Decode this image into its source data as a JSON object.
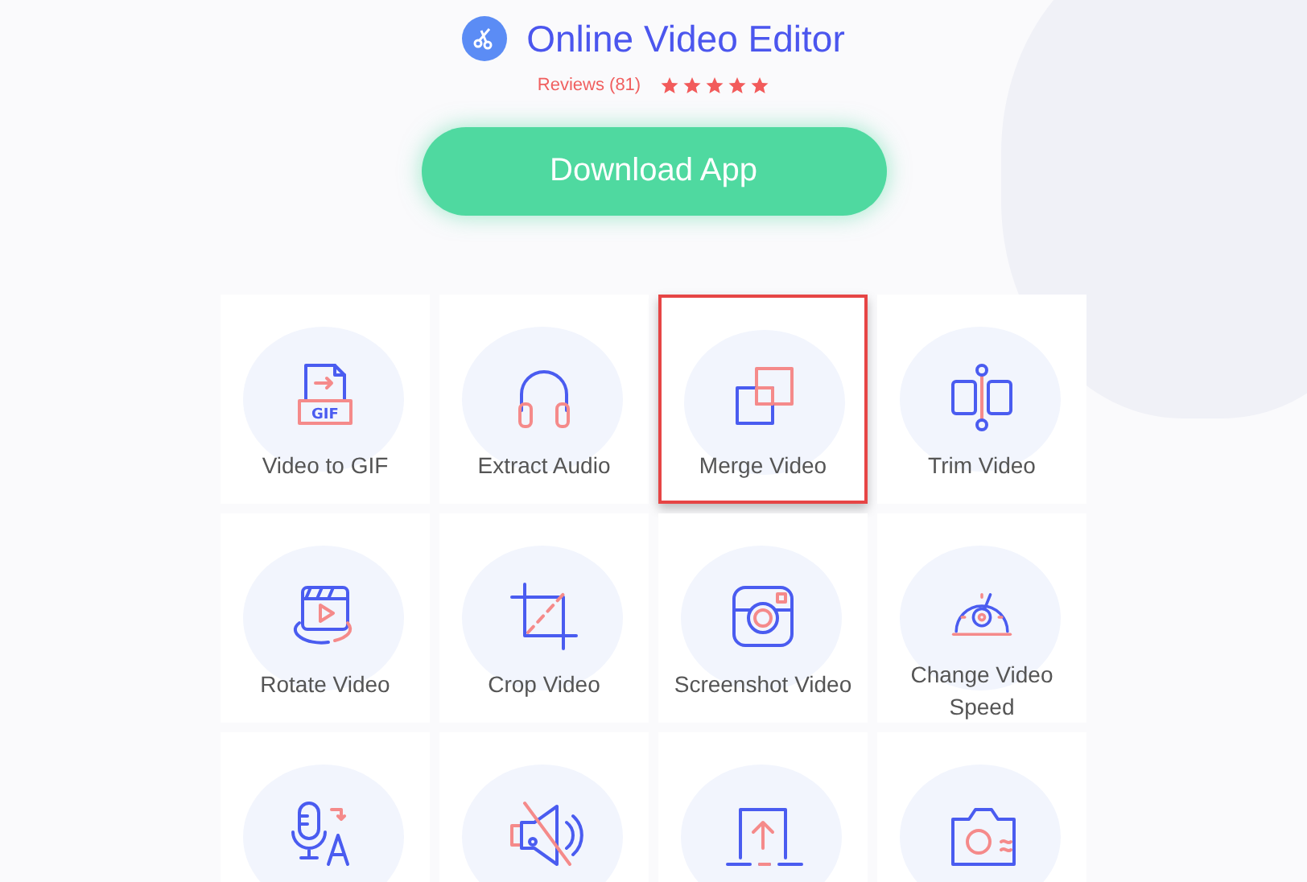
{
  "header": {
    "title": "Online Video Editor",
    "reviews": "Reviews (81)",
    "stars": 5
  },
  "download_button": {
    "label": "Download App"
  },
  "tools": [
    {
      "label": "Video to GIF",
      "kind": "gif",
      "icon_text": "GIF",
      "selected": false
    },
    {
      "label": "Extract Audio",
      "kind": "audio",
      "selected": false
    },
    {
      "label": "Merge Video",
      "kind": "merge",
      "selected": true
    },
    {
      "label": "Trim Video",
      "kind": "trim",
      "selected": false
    },
    {
      "label": "Rotate Video",
      "kind": "rotate",
      "selected": false
    },
    {
      "label": "Crop Video",
      "kind": "crop",
      "selected": false
    },
    {
      "label": "Screenshot Video",
      "kind": "screenshot",
      "selected": false
    },
    {
      "label": "Change Video Speed",
      "kind": "speed",
      "selected": false
    },
    {
      "kind": "voice",
      "selected": false
    },
    {
      "kind": "mute",
      "selected": false
    },
    {
      "kind": "upload",
      "selected": false
    },
    {
      "kind": "camera",
      "selected": false
    }
  ]
}
